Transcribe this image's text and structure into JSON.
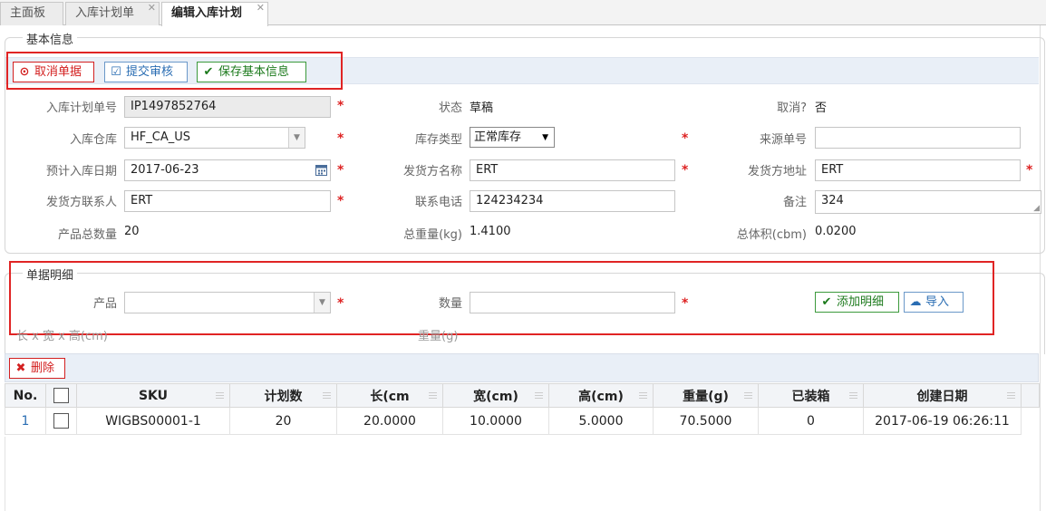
{
  "tabs": [
    {
      "label": "主面板",
      "closable": false
    },
    {
      "label": "入库计划单",
      "closable": true
    },
    {
      "label": "编辑入库计划",
      "closable": true,
      "active": true
    }
  ],
  "basic": {
    "legend": "基本信息",
    "buttons": {
      "cancel": "取消单据",
      "submit": "提交审核",
      "save": "保存基本信息"
    },
    "labels": {
      "plan_no": "入库计划单号",
      "status": "状态",
      "cancelled": "取消?",
      "warehouse": "入库仓库",
      "stock_type": "库存类型",
      "source_no": "来源单号",
      "eta": "预计入库日期",
      "shipper_name": "发货方名称",
      "shipper_addr": "发货方地址",
      "contact": "发货方联系人",
      "phone": "联系电话",
      "remark": "备注",
      "total_qty": "产品总数量",
      "total_weight": "总重量(kg)",
      "total_volume": "总体积(cbm)"
    },
    "values": {
      "plan_no": "IP1497852764",
      "status": "草稿",
      "cancelled": "否",
      "warehouse": "HF_CA_US",
      "stock_type": "正常库存",
      "source_no": "",
      "eta": "2017-06-23",
      "shipper_name": "ERT",
      "shipper_addr": "ERT",
      "contact": "ERT",
      "phone": "124234234",
      "remark": "324",
      "total_qty": "20",
      "total_weight": "1.4100",
      "total_volume": "0.0200"
    }
  },
  "detail": {
    "legend": "单据明细",
    "labels": {
      "product": "产品",
      "qty": "数量",
      "dims": "长 x 宽 x 高(cm)",
      "weight": "重量(g)"
    },
    "values": {
      "product": "",
      "qty": ""
    },
    "buttons": {
      "add": "添加明细",
      "import": "导入"
    }
  },
  "grid": {
    "delete_label": "删除",
    "columns": [
      "No.",
      "",
      "SKU",
      "计划数",
      "长(cm",
      "宽(cm)",
      "高(cm)",
      "重量(g)",
      "已装箱",
      "创建日期"
    ],
    "rows": [
      {
        "no": "1",
        "sku": "WIGBS00001-1",
        "plan_qty": "20",
        "length": "20.0000",
        "width": "10.0000",
        "height": "5.0000",
        "weight": "70.5000",
        "boxed": "0",
        "created": "2017-06-19 06:26:11"
      }
    ]
  },
  "colors": {
    "accent_red": "#d32020",
    "accent_blue": "#2a6db3",
    "accent_green": "#1c7a1c",
    "toolbar_bg": "#e9eff7"
  }
}
